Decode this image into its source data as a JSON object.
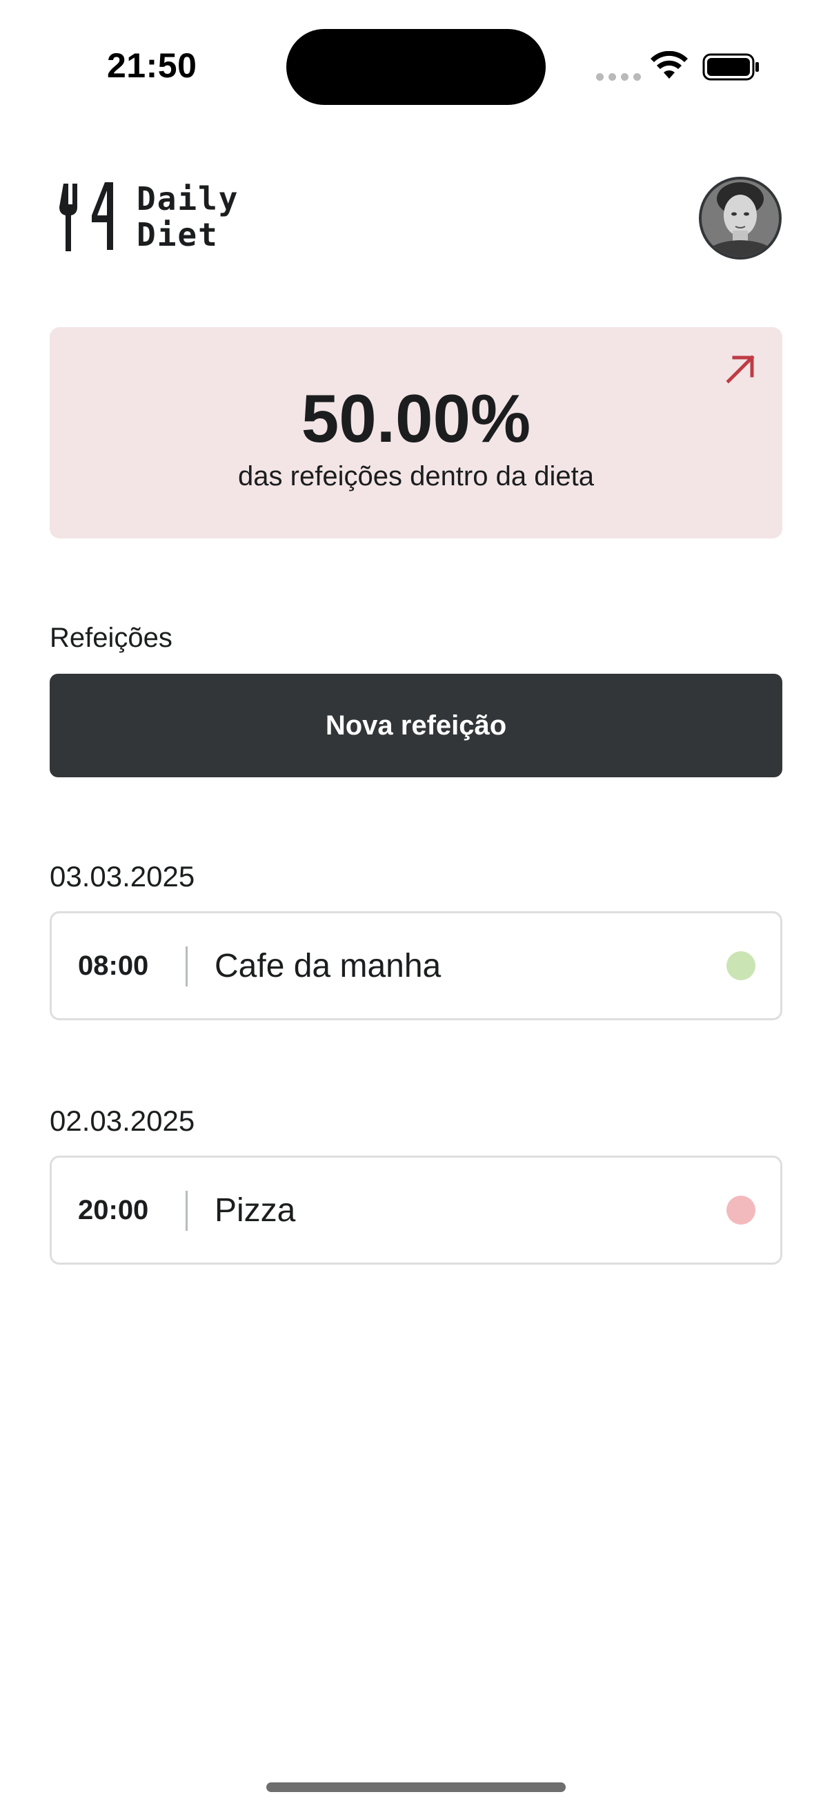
{
  "status_bar": {
    "time": "21:50"
  },
  "header": {
    "logo_line1": "Daily",
    "logo_line2": "Diet",
    "logo_icon": "fork-knife-icon",
    "avatar_icon": "user-avatar"
  },
  "stats": {
    "percent": "50.00%",
    "caption": "das refeições dentro da dieta",
    "arrow_icon": "arrow-up-right-icon",
    "accent_color": "#BF3B44",
    "background_color": "#F4E6E7"
  },
  "meals": {
    "section_label": "Refeições",
    "new_meal_label": "Nova refeição",
    "days": [
      {
        "date": "03.03.2025",
        "items": [
          {
            "time": "08:00",
            "name": "Cafe da manha",
            "status": "on-diet",
            "status_color": "#CBE4B4"
          }
        ]
      },
      {
        "date": "02.03.2025",
        "items": [
          {
            "time": "20:00",
            "name": "Pizza",
            "status": "off-diet",
            "status_color": "#F3BABD"
          }
        ]
      }
    ]
  }
}
